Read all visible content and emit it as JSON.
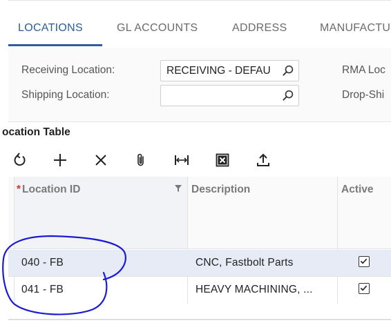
{
  "tabs": [
    {
      "label": "LOCATIONS",
      "active": true
    },
    {
      "label": "GL ACCOUNTS",
      "active": false
    },
    {
      "label": "ADDRESS",
      "active": false
    },
    {
      "label": "MANUFACTU",
      "active": false
    }
  ],
  "form": {
    "receiving_label": "Receiving Location:",
    "receiving_value": "RECEIVING - DEFAU",
    "shipping_label": "Shipping Location:",
    "shipping_value": "",
    "rma_label": "RMA Loc",
    "dropship_label": "Drop-Shi"
  },
  "section": {
    "title": "Location Table",
    "title_partial_visible": "ocation Table"
  },
  "toolbar": {
    "buttons": [
      "refresh-icon",
      "add-icon",
      "delete-icon",
      "paperclip-icon",
      "fit-columns-icon",
      "excel-export-icon",
      "upload-icon"
    ]
  },
  "grid": {
    "columns": {
      "location_id": "Location ID",
      "location_id_required": "*",
      "description": "Description",
      "active": "Active"
    },
    "rows": [
      {
        "location_id": "040 - FB",
        "description": "CNC, Fastbolt Parts",
        "active": true,
        "selected": true
      },
      {
        "location_id": "041 - FB",
        "description": "HEAVY MACHINING, ...",
        "active": true,
        "selected": false
      }
    ]
  },
  "colors": {
    "accent": "#2c5c99",
    "annotation": "#1a1ad6",
    "selected_row": "#e6ebf5"
  }
}
